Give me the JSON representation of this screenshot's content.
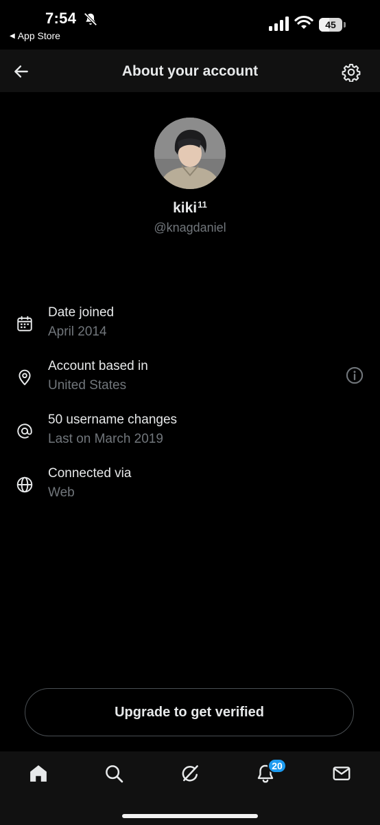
{
  "status_bar": {
    "time": "7:54",
    "back_app_label": "App Store",
    "battery_level": "45",
    "battery_fraction": 0.45
  },
  "header": {
    "title": "About your account"
  },
  "profile": {
    "display_name": "kiki",
    "display_name_superscript": "11",
    "handle": "@knagdaniel"
  },
  "info_rows": [
    {
      "icon": "calendar-icon",
      "label": "Date joined",
      "value": "April 2014"
    },
    {
      "icon": "location-pin-icon",
      "label": "Account based in",
      "value": "United States"
    },
    {
      "icon": "at-sign-icon",
      "label": "50 username changes",
      "value": "Last on March 2019"
    },
    {
      "icon": "globe-icon",
      "label": "Connected via",
      "value": "Web"
    }
  ],
  "upgrade_button": {
    "label": "Upgrade to get verified"
  },
  "bottom_nav": {
    "items": [
      "home-icon",
      "search-icon",
      "grok-icon",
      "notifications-icon",
      "messages-icon"
    ],
    "notifications_badge": "20"
  },
  "colors": {
    "background": "#000000",
    "header_bg": "#111111",
    "primary_text": "#e7e9ea",
    "secondary_text": "#71767b",
    "badge_blue": "#1d9bf0"
  }
}
